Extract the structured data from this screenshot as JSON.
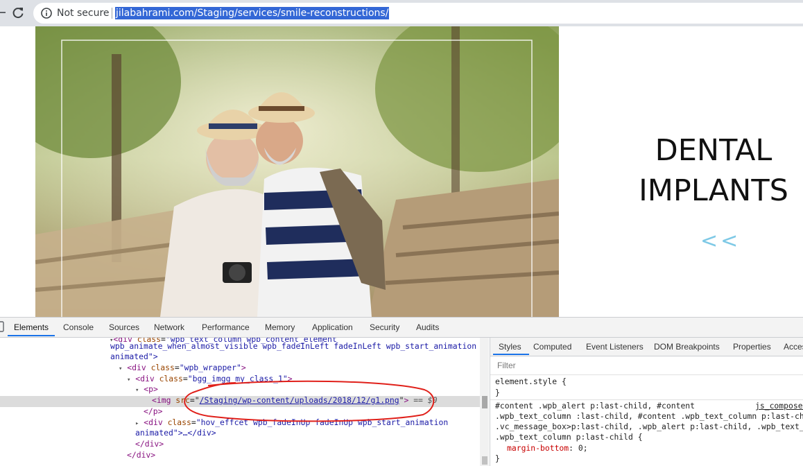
{
  "browser": {
    "security_label": "Not secure",
    "url": "jilabahrami.com/Staging/services/smile-reconstructions/"
  },
  "page": {
    "title": "DENTAL\nIMPLANTS",
    "back_arrows": "<<"
  },
  "devtools": {
    "tabs": [
      {
        "label": "Elements",
        "active": true
      },
      {
        "label": "Console"
      },
      {
        "label": "Sources"
      },
      {
        "label": "Network"
      },
      {
        "label": "Performance"
      },
      {
        "label": "Memory"
      },
      {
        "label": "Application"
      },
      {
        "label": "Security"
      },
      {
        "label": "Audits"
      }
    ],
    "dom": {
      "line0_tag_open": "<div ",
      "line0_attr": "class",
      "line0_val": "\"wpb_text_column wpb_content_element",
      "line1": "wpb_animate_when_almost_visible wpb_fadeInLeft fadeInLeft wpb_start_animation",
      "line2": "animated\">",
      "line3_attr": "class",
      "line3_val": "\"wpb_wrapper\"",
      "line4_attr": "class",
      "line4_val": "\"bgg_imgg my_class_1\"",
      "line5": "<p>",
      "line6_attr": "src",
      "line6_link": "/Staging/wp-content/uploads/2018/12/g1.png",
      "line6_tail": " == $0",
      "line7": "</p>",
      "line8_attr": "class",
      "line8_val": "\"hov_effcet wpb_fadeInUp fadeInUp wpb_start_animation",
      "line9": "animated\">…</div>",
      "line10": "</div>",
      "line11": "</div>"
    },
    "styles_tabs": [
      {
        "label": "Styles",
        "active": true
      },
      {
        "label": "Computed"
      },
      {
        "label": "Event Listeners"
      },
      {
        "label": "DOM Breakpoints"
      },
      {
        "label": "Properties"
      },
      {
        "label": "Accessibility"
      }
    ],
    "filter_placeholder": "Filter",
    "element_style": "element.style {",
    "close_brace": "}",
    "rule_selector_1": "#content .wpb_alert p:last-child, #content",
    "rule_source": "js_composer",
    "rule_selector_2": ".wpb_text_column :last-child, #content .wpb_text_column p:last-child,",
    "rule_selector_3": ".vc_message_box>p:last-child, .wpb_alert p:last-child, .wpb_text_column",
    "rule_selector_4": ".wpb_text_column p:last-child {",
    "rule_prop": "margin-bottom",
    "rule_value": "0;",
    "rule_close": "}"
  }
}
